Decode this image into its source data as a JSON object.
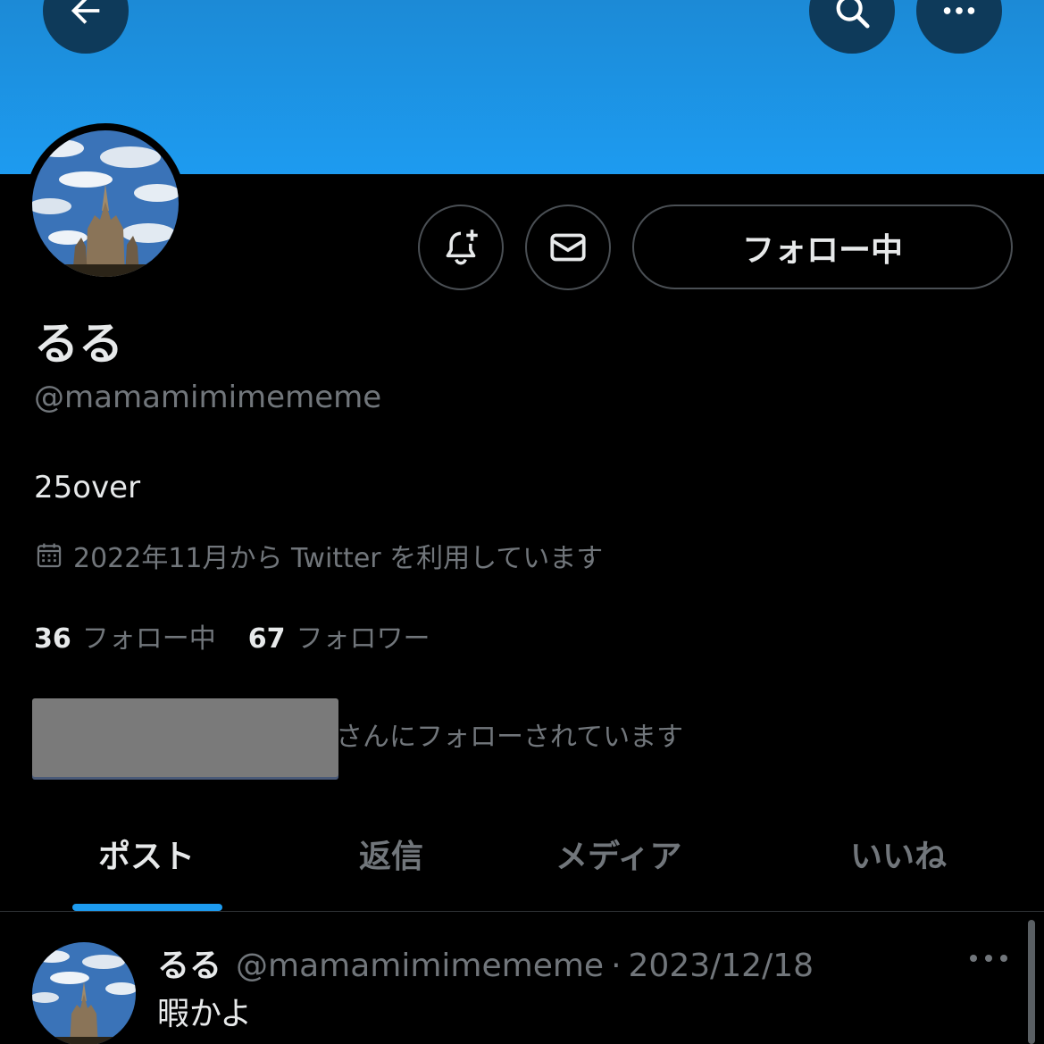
{
  "header": {
    "back_icon": "arrow-left-icon",
    "search_icon": "search-icon",
    "more_icon": "more-horizontal-icon",
    "banner_color": "#1d9bf0"
  },
  "profile": {
    "display_name": "るる",
    "handle": "@mamamimimememe",
    "bio": "25over",
    "joined": "2022年11月から Twitter を利用しています",
    "follow_button_label": "フォロー中",
    "following_count": "36",
    "following_label": "フォロー中",
    "followers_count": "67",
    "followers_label": "フォロワー",
    "followed_by_text": "さんにフォローされています"
  },
  "tabs": [
    {
      "label": "ポスト",
      "active": true
    },
    {
      "label": "返信",
      "active": false
    },
    {
      "label": "メディア",
      "active": false
    },
    {
      "label": "いいね",
      "active": false
    }
  ],
  "post": {
    "name": "るる",
    "handle": "@mamamimimememe",
    "separator": "·",
    "date": "2023/12/18",
    "text": "暇かよ"
  },
  "colors": {
    "accent": "#1d9bf0",
    "background": "#000000",
    "secondary_text": "#71767b",
    "primary_text": "#e7e9ea"
  }
}
